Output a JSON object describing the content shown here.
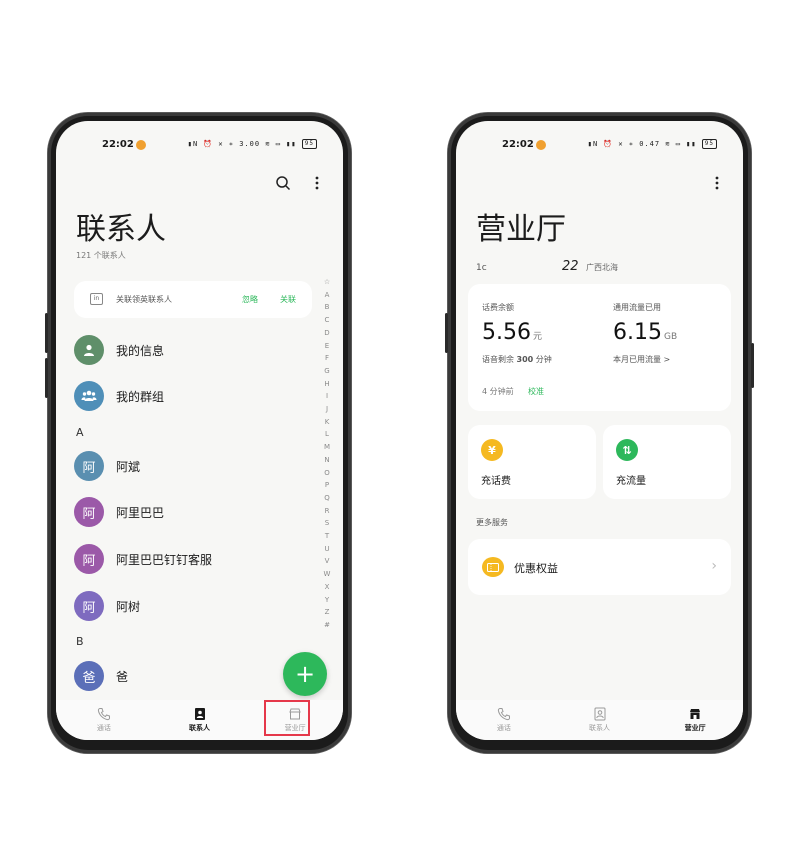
{
  "status": {
    "time": "22:02",
    "left_speed": "3.00",
    "right_speed": "0.47",
    "speed_unit": "K/s",
    "battery": "95"
  },
  "contacts_screen": {
    "title": "联系人",
    "count": "121 个联系人",
    "linkedin": {
      "text": "关联领英联系人",
      "ignore": "忽略",
      "link": "关联",
      "icon_text": "in"
    },
    "my_info": "我的信息",
    "my_groups": "我的群组",
    "sections": [
      {
        "letter": "A",
        "contacts": [
          {
            "initial": "阿",
            "name": "阿斌",
            "color": "#5a8fb0"
          },
          {
            "initial": "阿",
            "name": "阿里巴巴",
            "color": "#9b59a8"
          },
          {
            "initial": "阿",
            "name": "阿里巴巴钉钉客服",
            "color": "#9b59a8"
          },
          {
            "initial": "阿",
            "name": "阿树",
            "color": "#7e6bbf"
          }
        ]
      },
      {
        "letter": "B",
        "contacts": [
          {
            "initial": "爸",
            "name": "爸",
            "color": "#5b6fb8"
          }
        ]
      }
    ],
    "index": [
      "☆",
      "A",
      "B",
      "C",
      "D",
      "E",
      "F",
      "G",
      "H",
      "I",
      "J",
      "K",
      "L",
      "M",
      "N",
      "O",
      "P",
      "Q",
      "R",
      "S",
      "T",
      "U",
      "V",
      "W",
      "X",
      "Y",
      "Z",
      "#"
    ],
    "fab": "+"
  },
  "business_screen": {
    "title": "营业厅",
    "phone_prefix": "1c",
    "phone_suffix": "22",
    "region": "广西北海",
    "balance_label": "话费余额",
    "balance_value": "5.56",
    "balance_unit": "元",
    "voice_left_prefix": "语音剩余",
    "voice_left_value": "300",
    "voice_left_unit": "分钟",
    "data_label": "通用流量已用",
    "data_value": "6.15",
    "data_unit": "GB",
    "data_link": "本月已用流量 >",
    "updated": "4 分钟前",
    "calibrate": "校准",
    "recharge_fee": "充话费",
    "recharge_fee_icon": "¥",
    "recharge_data": "充流量",
    "recharge_data_icon": "⇅",
    "more_services": "更多服务",
    "benefits": "优惠权益"
  },
  "tabs": {
    "calls": "通话",
    "contacts": "联系人",
    "business": "营业厅"
  },
  "colors": {
    "accent_green": "#2db85b",
    "highlight_red": "#e5384a",
    "yellow": "#f5b921"
  }
}
